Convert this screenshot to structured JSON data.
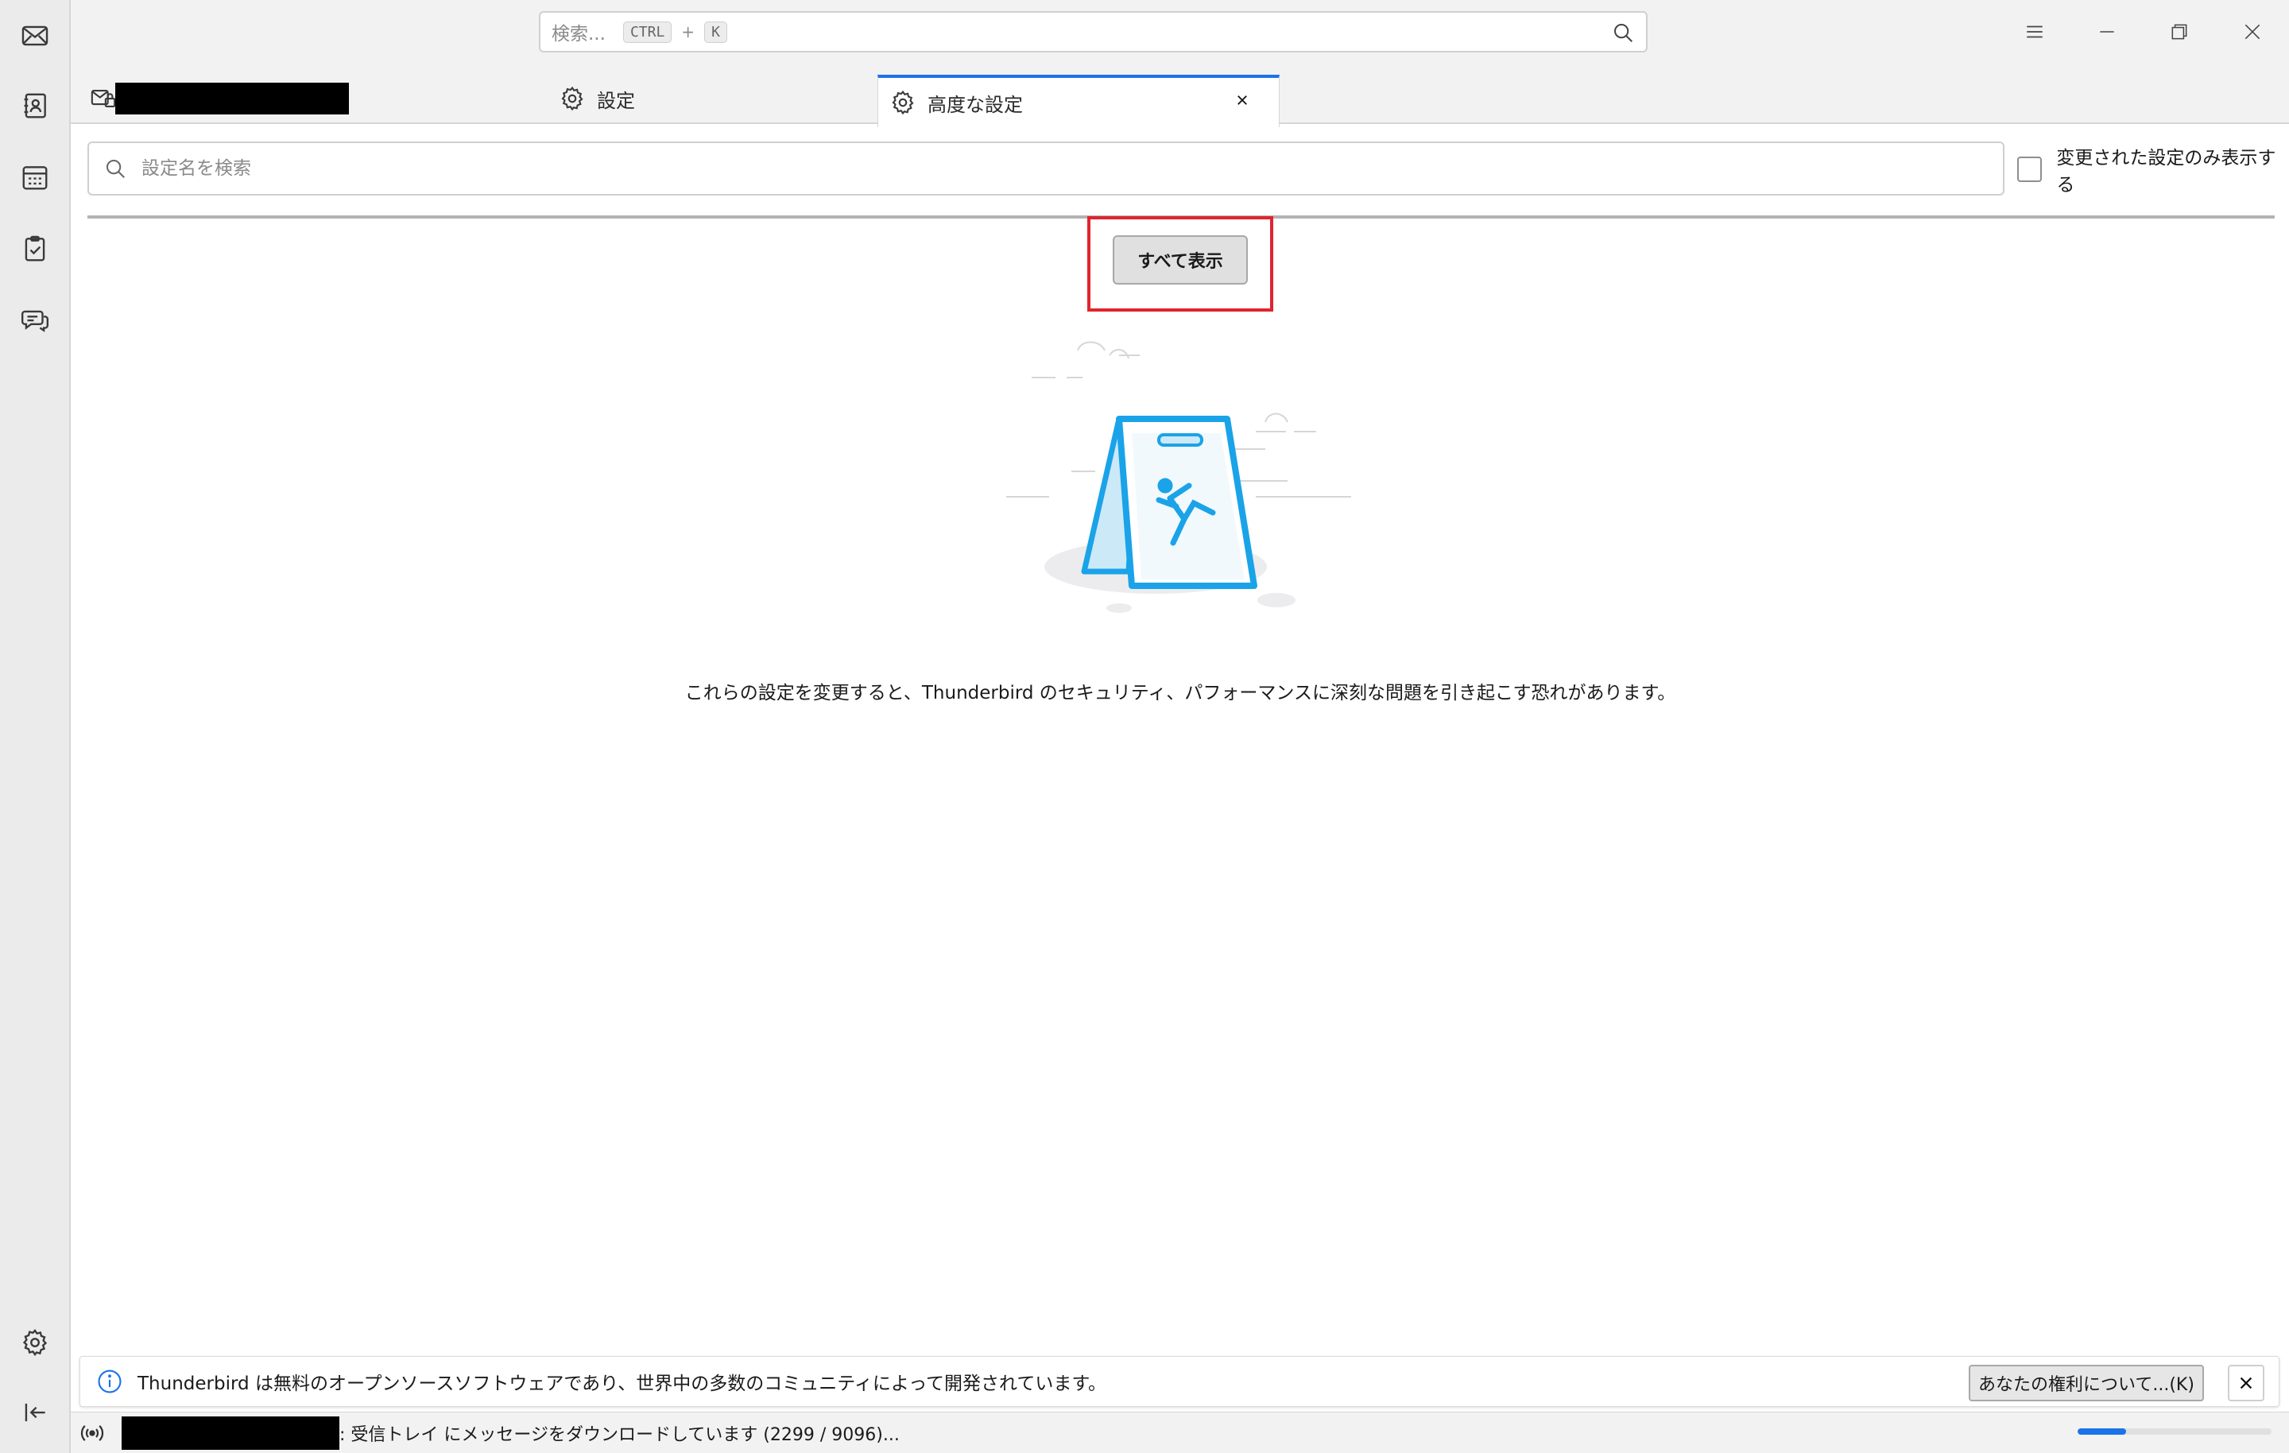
{
  "title_bar": {
    "search_placeholder": "検索...",
    "shortcut_ctrl": "CTRL",
    "shortcut_plus": "+",
    "shortcut_key": "K"
  },
  "tabs": [
    {
      "label": "",
      "icon": "mail-folder-icon",
      "redacted": true
    },
    {
      "label": "設定",
      "icon": "gear-icon"
    },
    {
      "label": "高度な設定",
      "icon": "gear-icon",
      "active": true
    }
  ],
  "config": {
    "search_placeholder": "設定名を検索",
    "modified_only_label": "変更された設定のみ表示する",
    "show_all_label": "すべて表示",
    "warning": "これらの設定を変更すると、Thunderbird のセキュリティ、パフォーマンスに深刻な問題を引き起こす恐れがあります。"
  },
  "notification": {
    "text": "Thunderbird は無料のオープンソースソフトウェアであり、世界中の多数のコミュニティによって開発されています。",
    "button_label": "あなたの権利について...(K)"
  },
  "status": {
    "text": ": 受信トレイ にメッセージをダウンロードしています (2299 / 9096)...",
    "progress": 0.25
  },
  "colors": {
    "accent": "#1b73e8",
    "highlight": "#e0242e",
    "illustration_blue": "#1aa3e8"
  }
}
